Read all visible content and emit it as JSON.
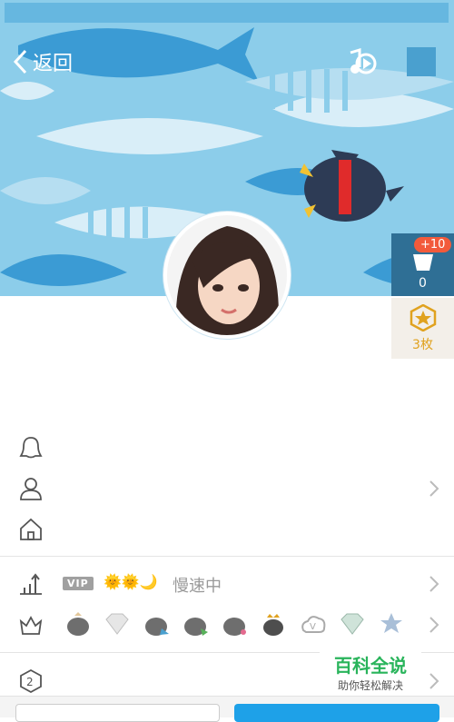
{
  "nav": {
    "back_label": "返回"
  },
  "side": {
    "cart_badge": "+10",
    "cart_count": "0",
    "coin_count": "3枚"
  },
  "speed": {
    "vip_label": "VIP",
    "suns": "🌞🌞🌙",
    "text": "慢速中"
  },
  "watermark": {
    "title": "百科全说",
    "subtitle": "助你轻松解决"
  },
  "colors": {
    "cover_bg": "#7fc6e8",
    "accent_blue": "#1ea1e8",
    "badge_red": "#f25a3b",
    "coin_gold": "#e0a21f"
  }
}
